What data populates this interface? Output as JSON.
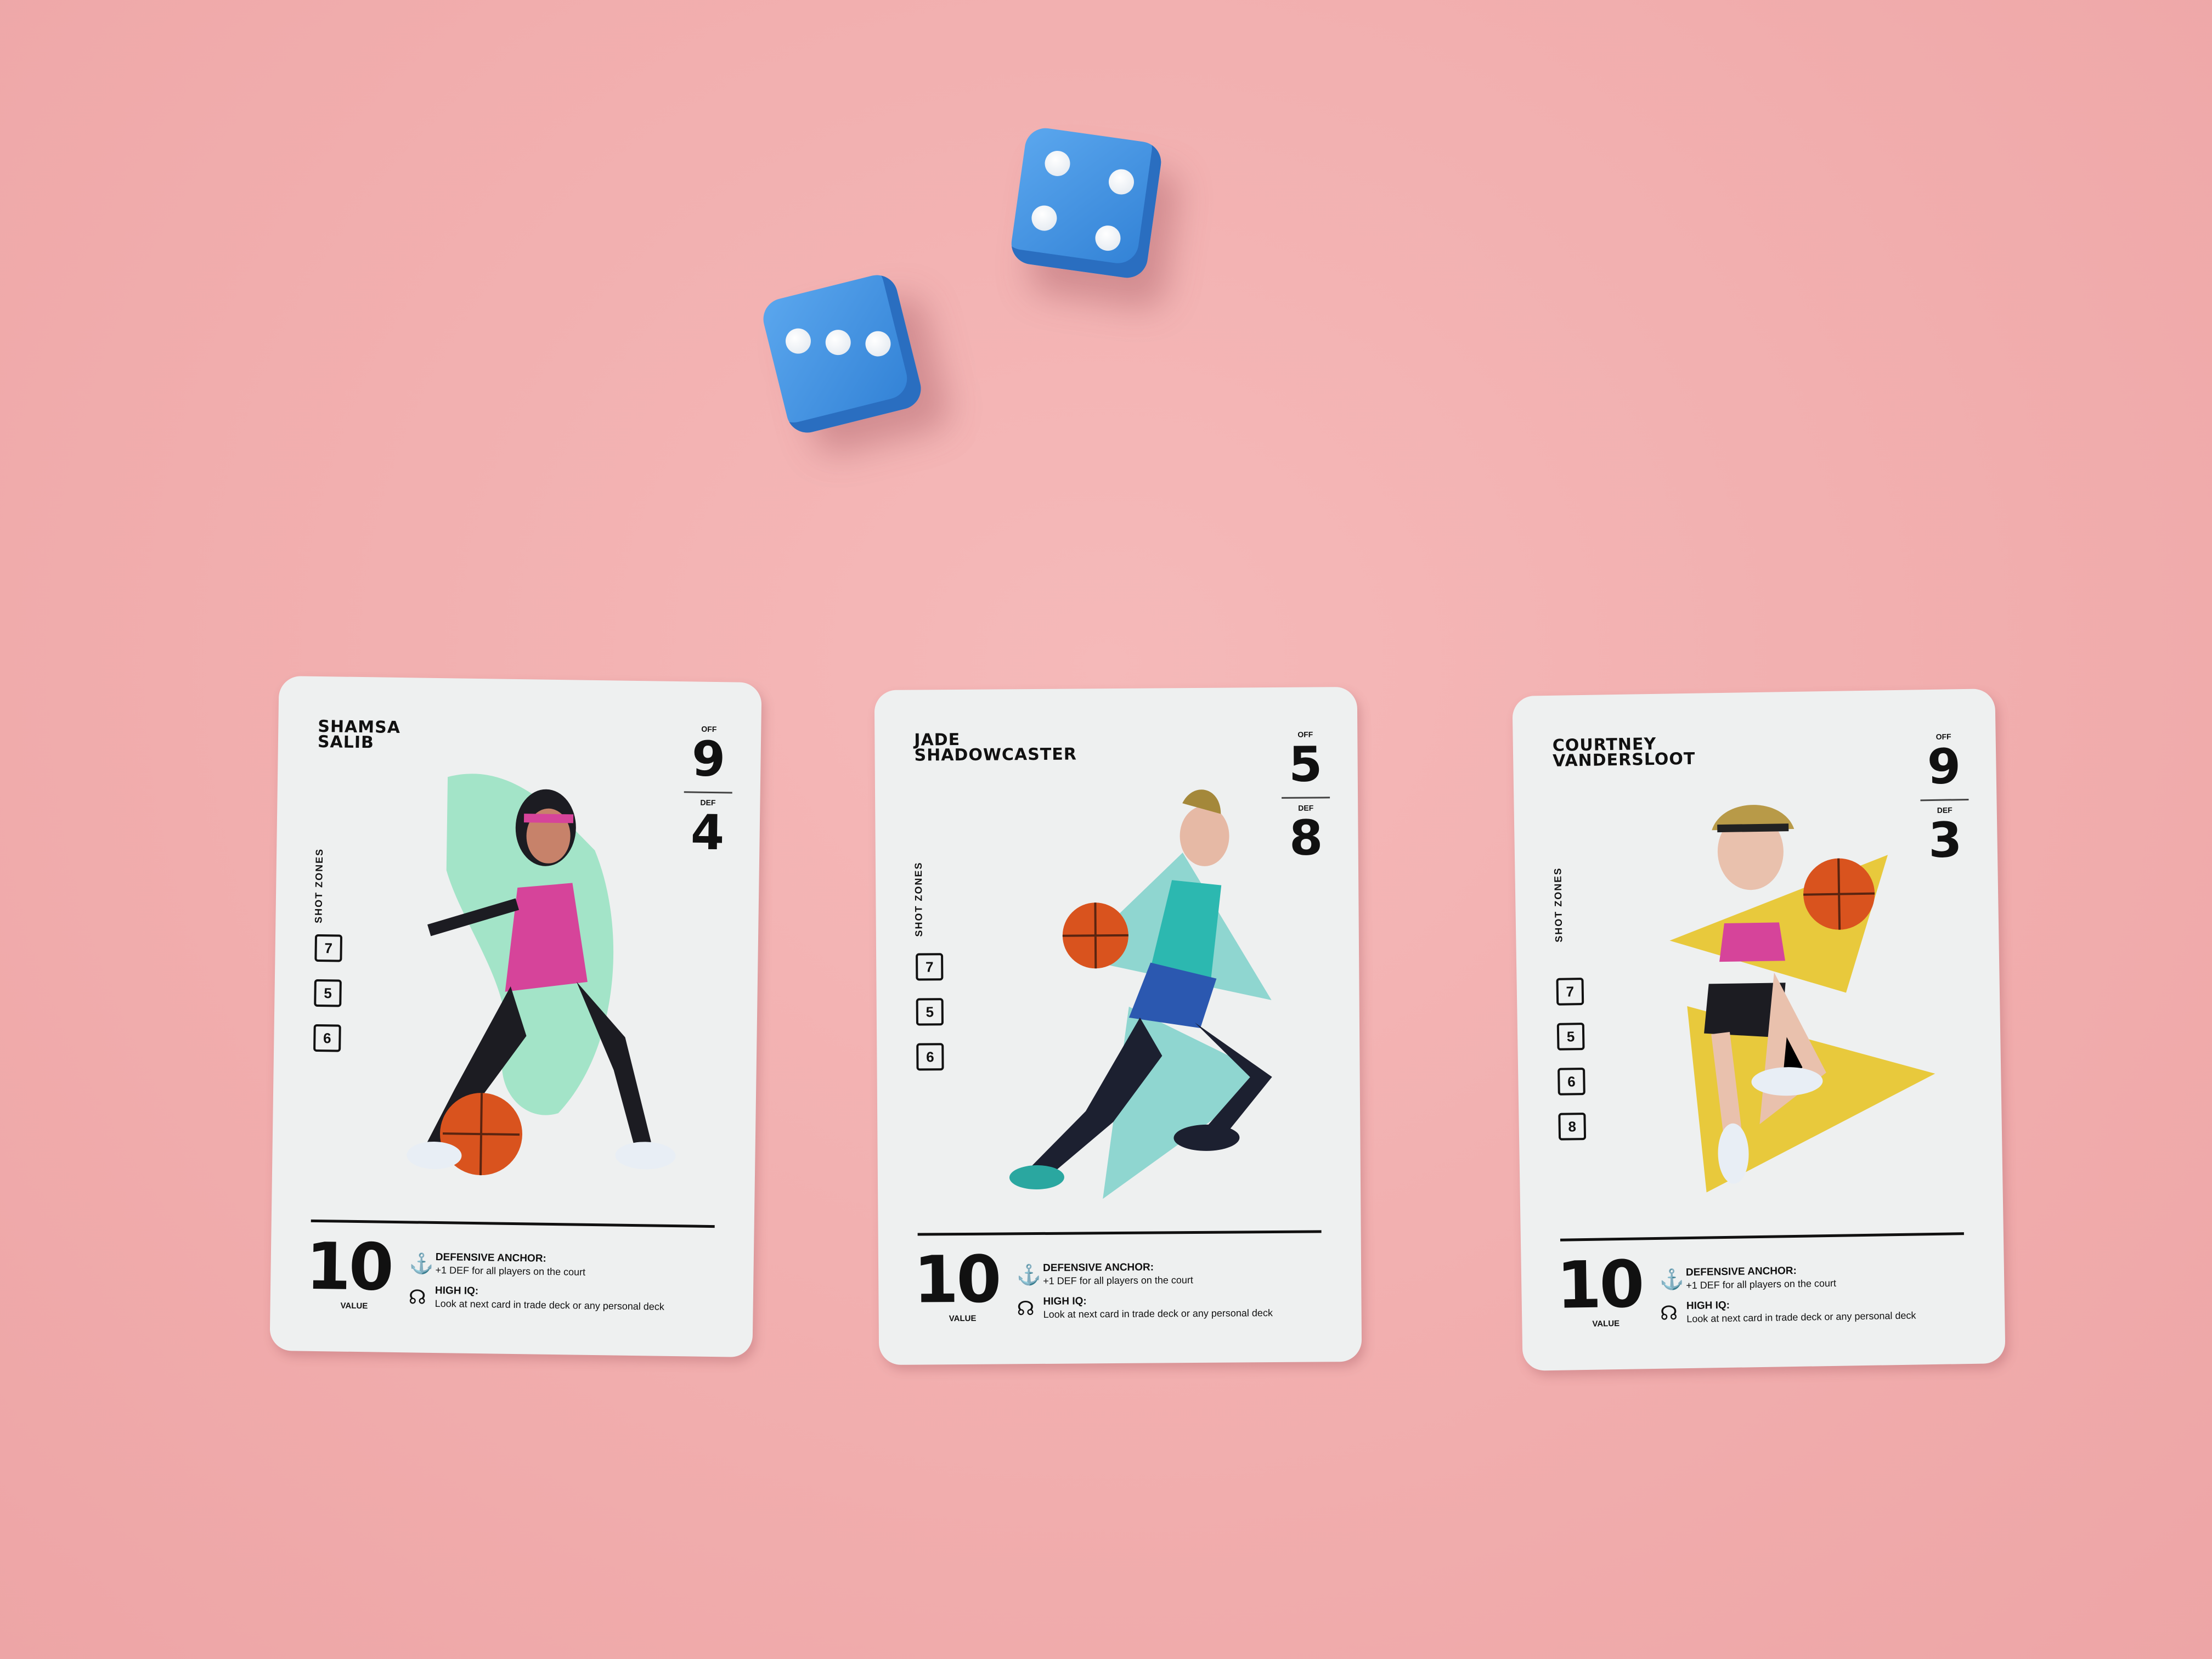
{
  "dice": [
    {
      "face": 4,
      "color": "#3b8fe0"
    },
    {
      "face": 3,
      "color": "#3b8fe0"
    }
  ],
  "cards": [
    {
      "name": "SHAMSA\nSALIB",
      "off_label": "OFF",
      "off": "9",
      "def_label": "DEF",
      "def": "4",
      "zones_label": "SHOT ZONES",
      "zones": [
        "7",
        "5",
        "6"
      ],
      "value": "10",
      "value_label": "VALUE",
      "accent": "#a3e4c8",
      "abilities": [
        {
          "icon": "anchor-icon",
          "title": "DEFENSIVE ANCHOR:",
          "text": "+1 DEF for all players on the court"
        },
        {
          "icon": "head-brain-icon",
          "title": "HIGH IQ:",
          "text": "Look at next card in trade deck or any personal deck"
        }
      ]
    },
    {
      "name": "JADE\nSHADOWCASTER",
      "off_label": "OFF",
      "off": "5",
      "def_label": "DEF",
      "def": "8",
      "zones_label": "SHOT ZONES",
      "zones": [
        "7",
        "5",
        "6"
      ],
      "value": "10",
      "value_label": "VALUE",
      "accent": "#8fd6d0",
      "abilities": [
        {
          "icon": "anchor-icon",
          "title": "DEFENSIVE ANCHOR:",
          "text": "+1 DEF for all players on the court"
        },
        {
          "icon": "head-brain-icon",
          "title": "HIGH IQ:",
          "text": "Look at next card in trade deck or any personal deck"
        }
      ]
    },
    {
      "name": "COURTNEY\nVANDERSLOOT",
      "off_label": "OFF",
      "off": "9",
      "def_label": "DEF",
      "def": "3",
      "zones_label": "SHOT ZONES",
      "zones": [
        "7",
        "5",
        "6",
        "8"
      ],
      "value": "10",
      "value_label": "VALUE",
      "accent": "#e8c93c",
      "abilities": [
        {
          "icon": "anchor-icon",
          "title": "DEFENSIVE ANCHOR:",
          "text": "+1 DEF for all players on the court"
        },
        {
          "icon": "head-brain-icon",
          "title": "HIGH IQ:",
          "text": "Look at next card in trade deck or any personal deck"
        }
      ]
    }
  ]
}
